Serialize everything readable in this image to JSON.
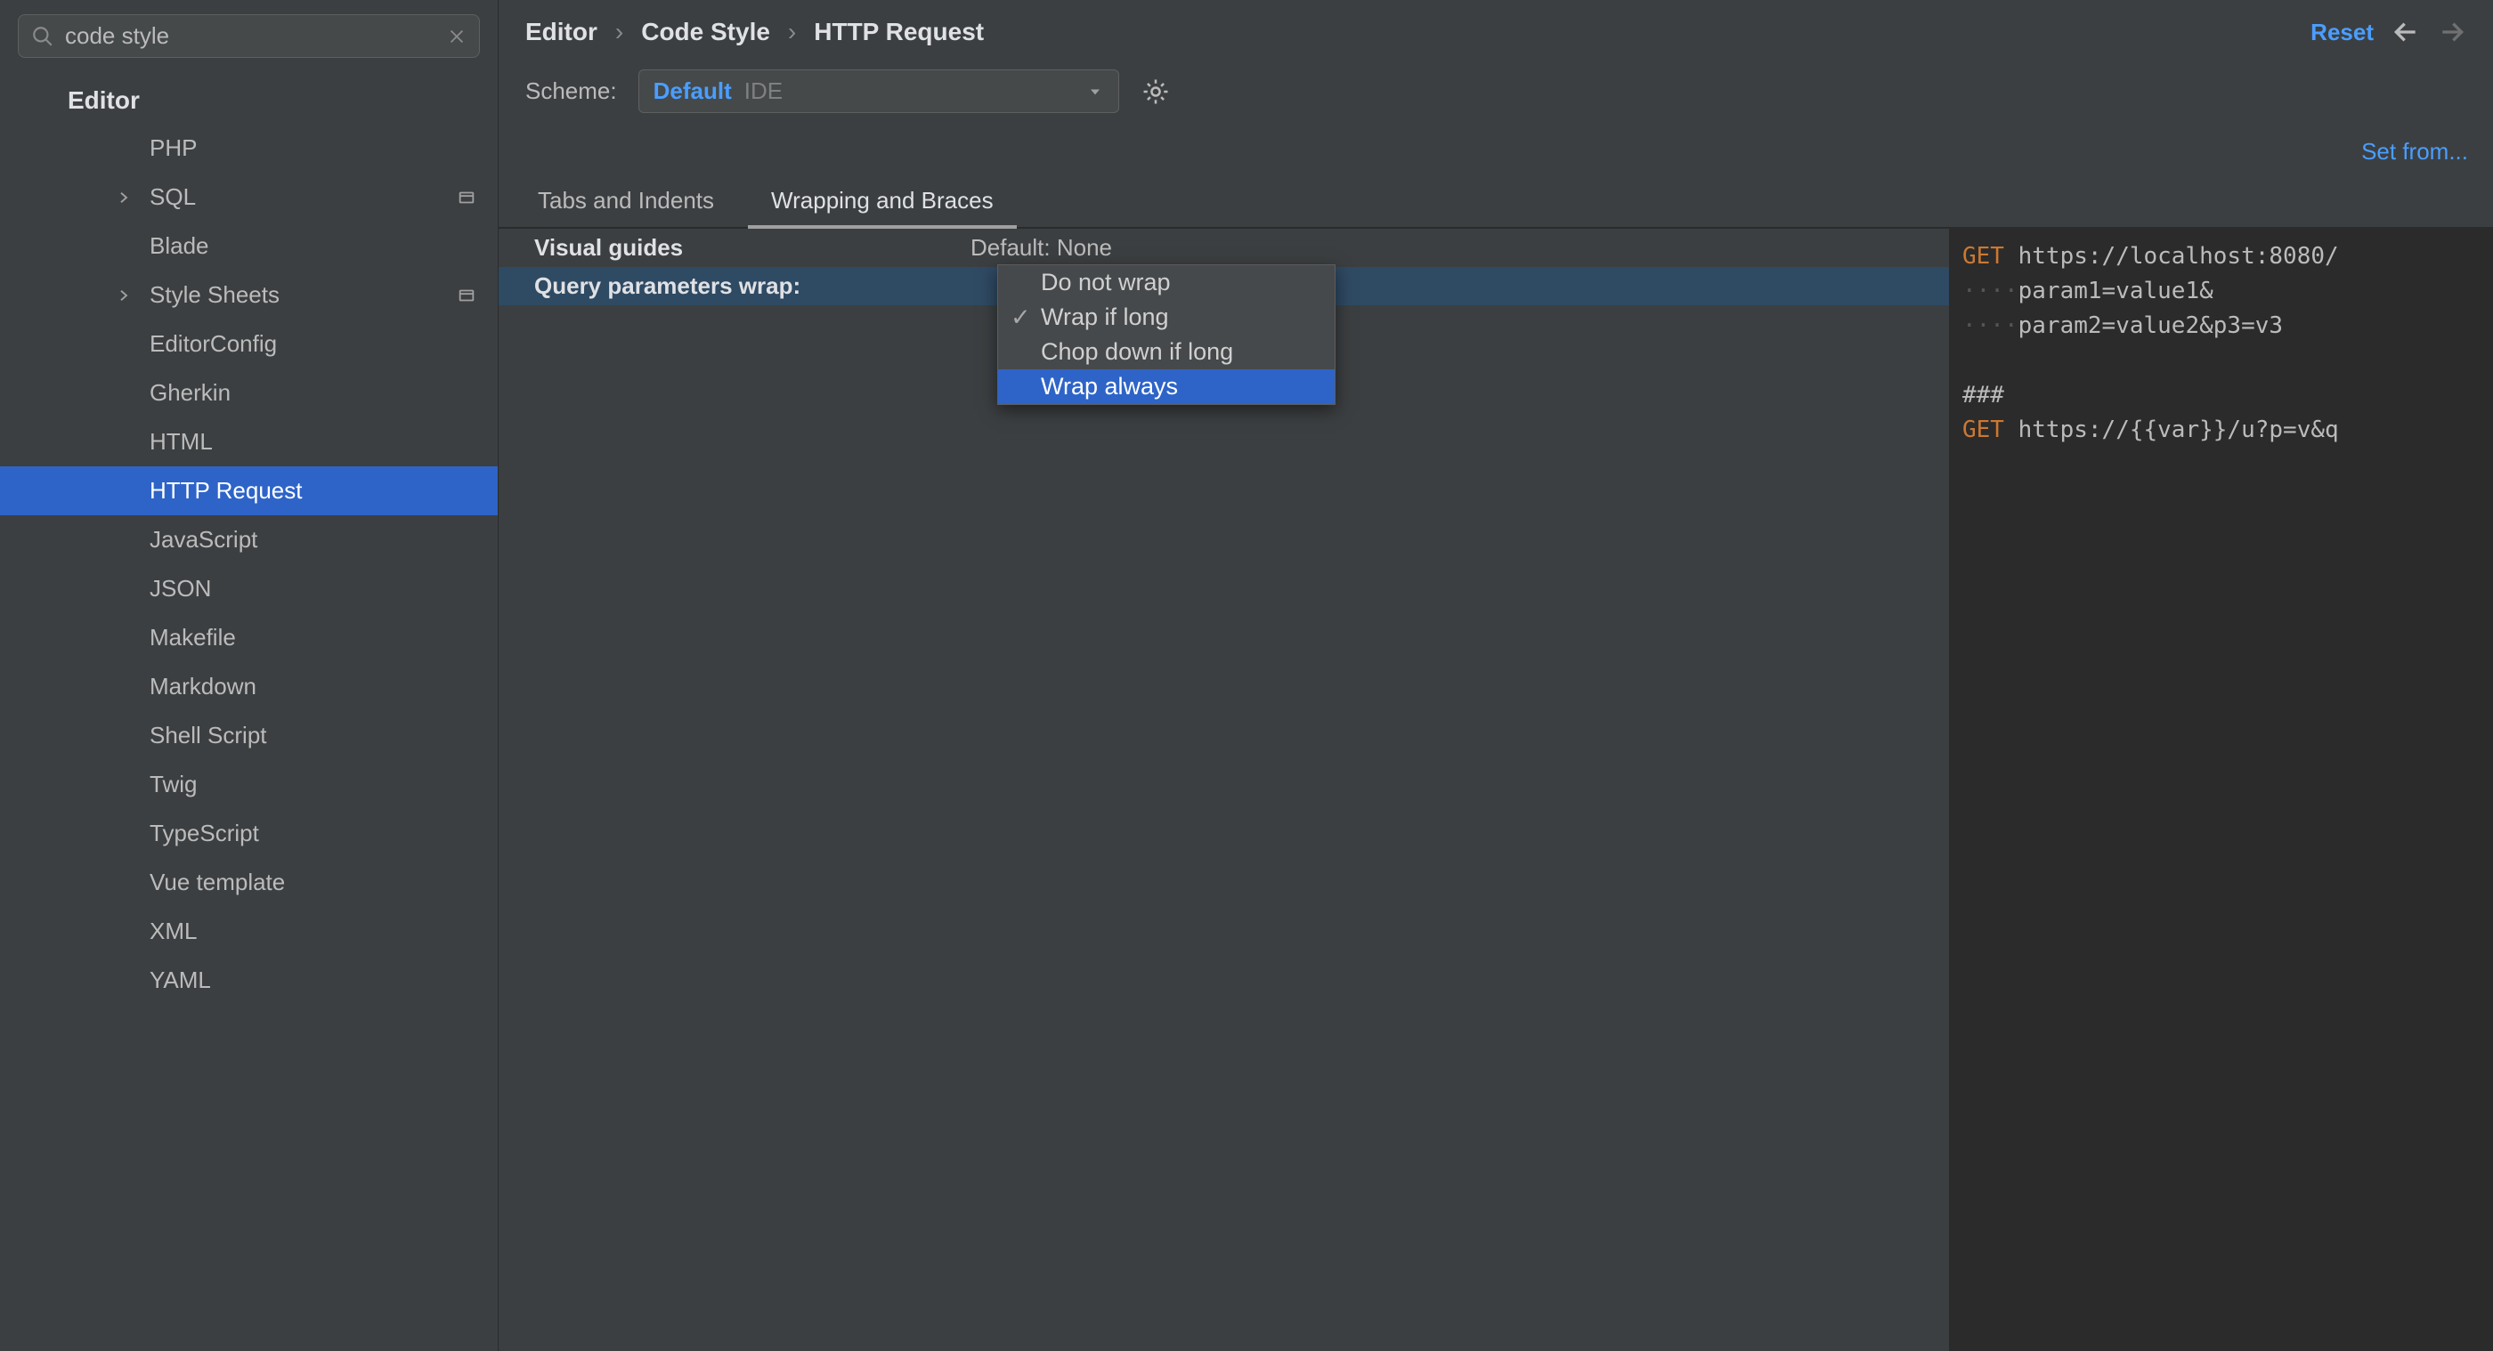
{
  "search": {
    "value": "code style"
  },
  "sidebar": {
    "group_label": "Editor",
    "items": [
      {
        "label": "PHP",
        "children": false,
        "selected": false,
        "extra": false
      },
      {
        "label": "SQL",
        "children": true,
        "selected": false,
        "extra": true
      },
      {
        "label": "Blade",
        "children": false,
        "selected": false,
        "extra": false
      },
      {
        "label": "Style Sheets",
        "children": true,
        "selected": false,
        "extra": true
      },
      {
        "label": "EditorConfig",
        "children": false,
        "selected": false,
        "extra": false
      },
      {
        "label": "Gherkin",
        "children": false,
        "selected": false,
        "extra": false
      },
      {
        "label": "HTML",
        "children": false,
        "selected": false,
        "extra": false
      },
      {
        "label": "HTTP Request",
        "children": false,
        "selected": true,
        "extra": false
      },
      {
        "label": "JavaScript",
        "children": false,
        "selected": false,
        "extra": false
      },
      {
        "label": "JSON",
        "children": false,
        "selected": false,
        "extra": false
      },
      {
        "label": "Makefile",
        "children": false,
        "selected": false,
        "extra": false
      },
      {
        "label": "Markdown",
        "children": false,
        "selected": false,
        "extra": false
      },
      {
        "label": "Shell Script",
        "children": false,
        "selected": false,
        "extra": false
      },
      {
        "label": "Twig",
        "children": false,
        "selected": false,
        "extra": false
      },
      {
        "label": "TypeScript",
        "children": false,
        "selected": false,
        "extra": false
      },
      {
        "label": "Vue template",
        "children": false,
        "selected": false,
        "extra": false
      },
      {
        "label": "XML",
        "children": false,
        "selected": false,
        "extra": false
      },
      {
        "label": "YAML",
        "children": false,
        "selected": false,
        "extra": false
      }
    ]
  },
  "breadcrumb": [
    "Editor",
    "Code Style",
    "HTTP Request"
  ],
  "topbar": {
    "reset": "Reset"
  },
  "scheme": {
    "label": "Scheme:",
    "value_main": "Default",
    "value_scope": "IDE"
  },
  "setfrom": "Set from...",
  "tabs": [
    {
      "label": "Tabs and Indents",
      "active": false
    },
    {
      "label": "Wrapping and Braces",
      "active": true
    }
  ],
  "settings": [
    {
      "label": "Visual guides",
      "value": "Default: None",
      "highlight": false
    },
    {
      "label": "Query parameters wrap:",
      "value": "",
      "highlight": true
    }
  ],
  "dropdown": {
    "items": [
      {
        "label": "Do not wrap",
        "checked": false,
        "selected": false
      },
      {
        "label": "Wrap if long",
        "checked": true,
        "selected": false
      },
      {
        "label": "Chop down if long",
        "checked": false,
        "selected": false
      },
      {
        "label": "Wrap always",
        "checked": false,
        "selected": true
      }
    ]
  },
  "preview": {
    "lines": [
      {
        "type": "req",
        "method": "GET",
        "url": "https://localhost:8080/"
      },
      {
        "type": "cont",
        "text": "param1=value1&"
      },
      {
        "type": "cont",
        "text": "param2=value2&p3=v3"
      },
      {
        "type": "blank"
      },
      {
        "type": "sep",
        "text": "###"
      },
      {
        "type": "req",
        "method": "GET",
        "url": "https://{{var}}/u?p=v&q"
      }
    ]
  }
}
